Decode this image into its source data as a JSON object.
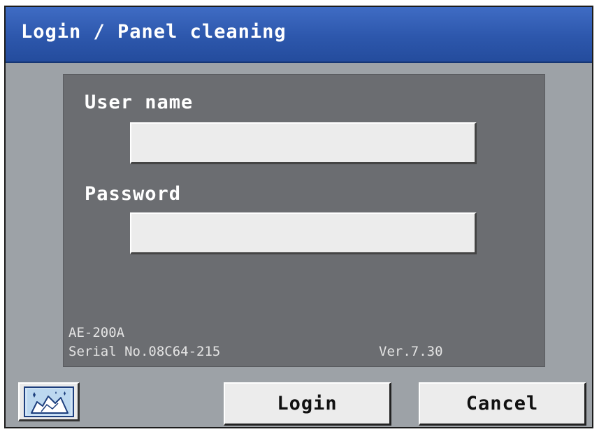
{
  "window": {
    "title": "Login / Panel cleaning"
  },
  "form": {
    "username_label": "User name",
    "username_value": "",
    "password_label": "Password",
    "password_value": ""
  },
  "device": {
    "model": "AE-200A",
    "serial": "Serial No.08C64-215",
    "version": "Ver.7.30"
  },
  "buttons": {
    "panel_cleaning_icon": "cleaning-cloth-icon",
    "login_label": "Login",
    "cancel_label": "Cancel"
  },
  "colors": {
    "titlebar": "#2d57ac",
    "screen_bg": "#9da2a7",
    "panel_bg": "#6b6d71",
    "button_bg": "#ececec"
  }
}
